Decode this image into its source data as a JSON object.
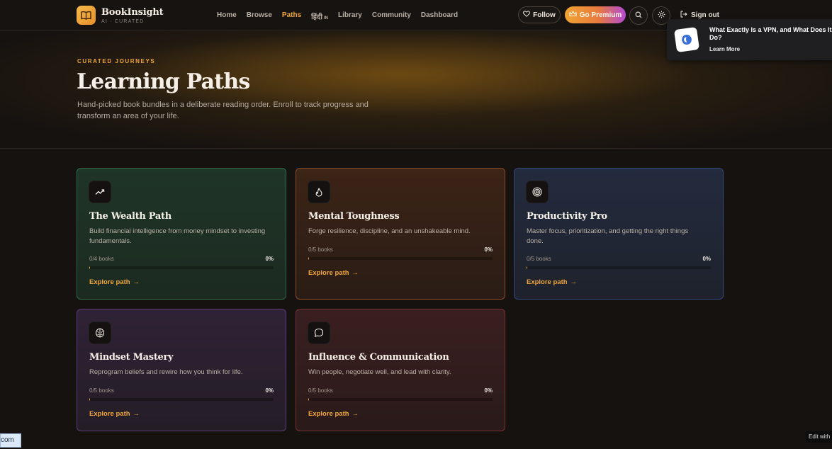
{
  "brand": {
    "name": "BookInsight",
    "tagline": "AI · CURATED"
  },
  "nav": {
    "links": [
      {
        "label": "Home",
        "active": false
      },
      {
        "label": "Browse",
        "active": false
      },
      {
        "label": "Paths",
        "active": true
      },
      {
        "label": "हिंदी",
        "suffix": "IN",
        "active": false
      },
      {
        "label": "Library",
        "active": false
      },
      {
        "label": "Community",
        "active": false
      },
      {
        "label": "Dashboard",
        "active": false
      }
    ],
    "follow_label": "Follow",
    "premium_label": "Go Premium",
    "signout_label": "Sign out"
  },
  "hero": {
    "eyebrow": "CURATED JOURNEYS",
    "title": "Learning Paths",
    "description": "Hand-picked book bundles in a deliberate reading order. Enroll to track progress and transform an area of your life."
  },
  "paths": [
    {
      "title": "The Wealth Path",
      "description": "Build financial intelligence from money mindset to investing fundamentals.",
      "count": "0/4 books",
      "percent": "0%",
      "progress": 0,
      "explore": "Explore path",
      "icon": "trending-up-icon"
    },
    {
      "title": "Mental Toughness",
      "description": "Forge resilience, discipline, and an unshakeable mind.",
      "count": "0/5 books",
      "percent": "0%",
      "progress": 0,
      "explore": "Explore path",
      "icon": "flame-icon"
    },
    {
      "title": "Productivity Pro",
      "description": "Master focus, prioritization, and getting the right things done.",
      "count": "0/5 books",
      "percent": "0%",
      "progress": 0,
      "explore": "Explore path",
      "icon": "target-icon"
    },
    {
      "title": "Mindset Mastery",
      "description": "Reprogram beliefs and rewire how you think for life.",
      "count": "0/5 books",
      "percent": "0%",
      "progress": 0,
      "explore": "Explore path",
      "icon": "brain-icon"
    },
    {
      "title": "Influence & Communication",
      "description": "Win people, negotiate well, and lead with clarity.",
      "count": "0/5 books",
      "percent": "0%",
      "progress": 0,
      "explore": "Explore path",
      "icon": "chat-bubble-icon"
    }
  ],
  "toast": {
    "title": "What Exactly Is a VPN, and What Does It",
    "title_cont": "Do?",
    "link": "Learn More"
  },
  "status_url": "com",
  "edit_chip": "Edit with"
}
